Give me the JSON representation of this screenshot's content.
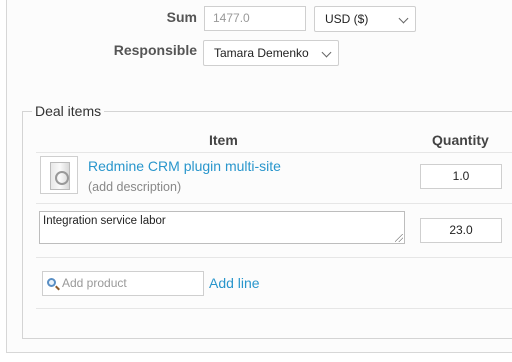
{
  "form": {
    "sum_label": "Sum",
    "sum_value": "1477.0",
    "currency_value": "USD ($)",
    "responsible_label": "Responsible",
    "responsible_value": "Tamara Demenko"
  },
  "deal_items": {
    "legend": "Deal items",
    "col_item": "Item",
    "col_quantity": "Quantity",
    "rows": [
      {
        "name": "Redmine CRM plugin multi-site",
        "description": "(add description)",
        "quantity": "1.0"
      },
      {
        "name": "Integration service labor",
        "quantity": "23.0"
      }
    ],
    "add_product_placeholder": "Add product",
    "add_line_label": "Add line"
  }
}
